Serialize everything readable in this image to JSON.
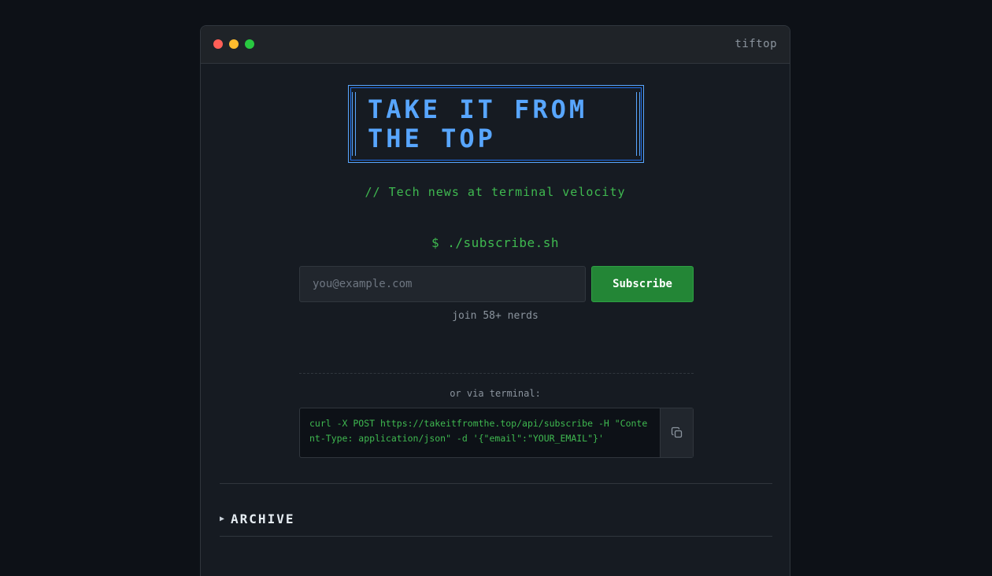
{
  "window": {
    "title": "tiftop"
  },
  "logo": {
    "line1": "TAKE IT FROM",
    "line2": "THE TOP"
  },
  "tagline": "// Tech news at terminal velocity",
  "subscribe": {
    "command": "$ ./subscribe.sh",
    "placeholder": "you@example.com",
    "button_label": "Subscribe",
    "join_text": "join 58+ nerds"
  },
  "terminal": {
    "label": "or via terminal:",
    "code": "curl -X POST https://takeitfromthe.top/api/subscribe -H \"Content-Type: application/json\" -d '{\"email\":\"YOUR_EMAIL\"}'",
    "copy_icon": "copy-icon"
  },
  "archive": {
    "label": "ARCHIVE",
    "toggle_icon": "triangle-right-icon"
  },
  "colors": {
    "accent_blue": "#58a6ff",
    "accent_green": "#3fb950",
    "button_green": "#238636"
  }
}
